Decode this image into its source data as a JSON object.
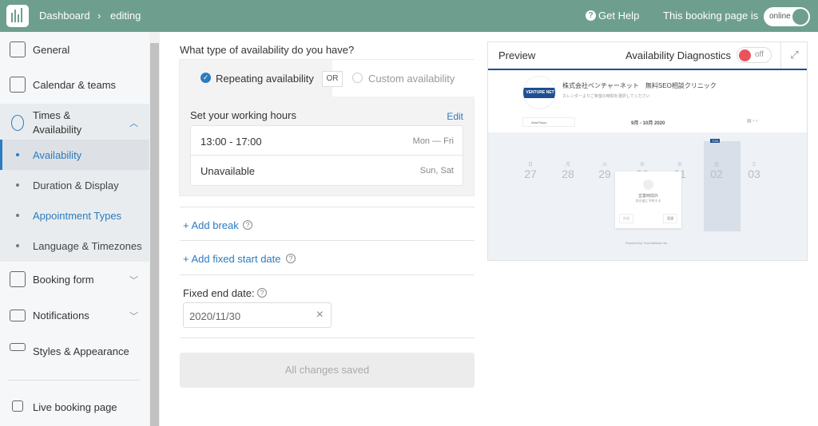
{
  "header": {
    "breadcrumb": [
      "Dashboard",
      "editing"
    ],
    "help": "Get Help",
    "status_label": "This booking page is",
    "status_toggle": "online",
    "brand_color": "#6e9f8e"
  },
  "sidebar": {
    "items": [
      {
        "label": "General",
        "icon": "id-card-icon"
      },
      {
        "label": "Calendar & teams",
        "icon": "calendar-person-icon"
      },
      {
        "label": "Times & Availability",
        "icon": "watch-icon"
      },
      {
        "label": "Booking form",
        "icon": "form-edit-icon"
      },
      {
        "label": "Notifications",
        "icon": "envelope-icon"
      },
      {
        "label": "Styles & Appearance",
        "icon": "paint-roller-icon"
      }
    ],
    "sub_items": [
      {
        "label": "Availability",
        "active": true
      },
      {
        "label": "Duration & Display"
      },
      {
        "label": "Appointment Types"
      },
      {
        "label": "Language & Timezones"
      }
    ],
    "live": "Live booking page"
  },
  "main": {
    "question": "What type of availability do you have?",
    "option_repeating": "Repeating availability",
    "or": "OR",
    "option_custom": "Custom availability",
    "hours_title": "Set your working hours",
    "edit": "Edit",
    "hours": [
      {
        "time": "13:00 - 17:00",
        "days": "Mon — Fri"
      },
      {
        "time": "Unavailable",
        "days": "Sun, Sat"
      }
    ],
    "add_break": "+ Add break",
    "add_start": "+ Add fixed start date",
    "end_label": "Fixed end date:",
    "end_value": "2020/11/30",
    "save": "All changes saved"
  },
  "preview": {
    "title": "Preview",
    "diagnostics": "Availability Diagnostics",
    "diag_toggle": "off",
    "logo_text": "VENTURE NET",
    "company": "株式会社ベンチャーネット　無料SEO相談クリニック",
    "subtitle": "カレンダーよりご希望の時間を選択してください",
    "timezone": "Asia/Tokyo",
    "range": "9月 - 10月 2020",
    "days": [
      {
        "w": "日",
        "d": "27"
      },
      {
        "w": "月",
        "d": "28"
      },
      {
        "w": "火",
        "d": "29"
      },
      {
        "w": "水",
        "d": "30"
      },
      {
        "w": "木",
        "d": "01"
      },
      {
        "w": "金",
        "d": "02"
      },
      {
        "w": "土",
        "d": "03"
      }
    ],
    "today_badge": "TOD",
    "empty_title": "営業時間外",
    "empty_sub": "別の週に予約する",
    "prev_btn": "前週",
    "next_btn": "翌週",
    "powered": "Powered by YouCanBook.me"
  }
}
